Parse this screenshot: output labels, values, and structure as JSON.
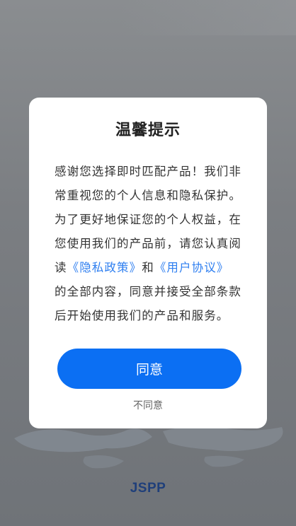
{
  "splash": {
    "brand_logo": "JSPP"
  },
  "dialog": {
    "title": "温馨提示",
    "body_intro": "感谢您选择即时匹配产品！我们非常重视您的个人信息和隐私保护。为了更好地保证您的个人权益，在您使用我们的产品前，请您认真阅读",
    "privacy_link": "《隐私政策》",
    "and_text": "和",
    "agreement_link": "《用户协议》",
    "body_outro": "的全部内容，同意并接受全部条款后开始使用我们的产品和服务。",
    "agree_label": "同意",
    "disagree_label": "不同意"
  },
  "colors": {
    "accent": "#0b6ff3",
    "link": "#2f7ff0",
    "overlay": "#777b80",
    "brand": "#1f3f7a"
  }
}
